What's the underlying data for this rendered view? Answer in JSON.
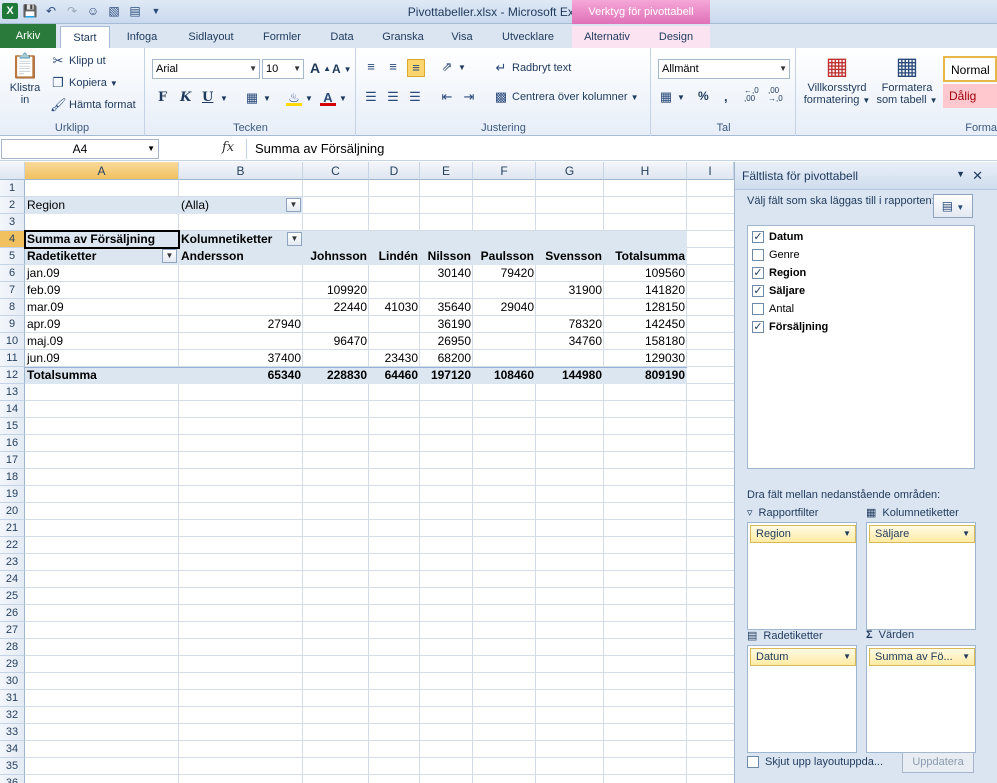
{
  "window": {
    "title": "Pivottabeller.xlsx - Microsoft Excel",
    "context_tool": "Verktyg för pivottabell"
  },
  "tabs": {
    "file": "Arkiv",
    "items": [
      "Start",
      "Infoga",
      "Sidlayout",
      "Formler",
      "Data",
      "Granska",
      "Visa",
      "Utvecklare"
    ],
    "context_items": [
      "Alternativ",
      "Design"
    ],
    "active": "Start"
  },
  "ribbon": {
    "clipboard": {
      "paste_line1": "Klistra",
      "paste_line2": "in",
      "cut": "Klipp ut",
      "copy": "Kopiera",
      "format_painter": "Hämta format",
      "label": "Urklipp"
    },
    "font": {
      "family": "Arial",
      "size": "10",
      "bold": "F",
      "italic": "K",
      "underline": "U",
      "label": "Tecken"
    },
    "alignment": {
      "wrap_text": "Radbryt text",
      "merge_center": "Centrera över kolumner",
      "label": "Justering"
    },
    "number": {
      "format": "Allmänt",
      "percent": "%",
      "comma": ",",
      "inc_decimal": "←,0 ,00",
      "dec_decimal": ",00 →,0",
      "label": "Tal"
    },
    "styles": {
      "cond_format_line1": "Villkorsstyrd",
      "cond_format_line2": "formatering",
      "format_table_line1": "Formatera",
      "format_table_line2": "som tabell",
      "style_normal": "Normal",
      "style_bad": "Dålig",
      "label": "Forma"
    }
  },
  "formula_bar": {
    "name_box": "A4",
    "fx": "fx",
    "content": "Summa av Försäljning"
  },
  "columns": [
    "A",
    "B",
    "C",
    "D",
    "E",
    "F",
    "G",
    "H",
    "I"
  ],
  "selected_column": "A",
  "selected_row": 4,
  "rows": [
    "1",
    "2",
    "3",
    "4",
    "5",
    "6",
    "7",
    "8",
    "9",
    "10",
    "11",
    "12",
    "13",
    "14",
    "15",
    "16",
    "17",
    "18",
    "19",
    "20",
    "21",
    "22",
    "23",
    "24",
    "25",
    "26",
    "27",
    "28",
    "29",
    "30",
    "31",
    "32",
    "33",
    "34",
    "35",
    "36"
  ],
  "pivot": {
    "filter_label": "Region",
    "filter_value": "(Alla)",
    "values_header": "Summa av Försäljning",
    "col_labels": "Kolumnetiketter",
    "row_labels": "Radetiketter",
    "sellers": [
      "Andersson",
      "Johnsson",
      "Lindén",
      "Nilsson",
      "Paulsson",
      "Svensson",
      "Totalsumma"
    ],
    "data_rows": [
      {
        "label": "jan.09",
        "values": [
          "",
          "",
          "",
          "30140",
          "79420",
          "",
          "109560"
        ]
      },
      {
        "label": "feb.09",
        "values": [
          "",
          "109920",
          "",
          "",
          "",
          "31900",
          "141820"
        ]
      },
      {
        "label": "mar.09",
        "values": [
          "",
          "22440",
          "41030",
          "35640",
          "29040",
          "",
          "128150"
        ]
      },
      {
        "label": "apr.09",
        "values": [
          "27940",
          "",
          "",
          "36190",
          "",
          "78320",
          "142450"
        ]
      },
      {
        "label": "maj.09",
        "values": [
          "",
          "96470",
          "",
          "26950",
          "",
          "34760",
          "158180"
        ]
      },
      {
        "label": "jun.09",
        "values": [
          "37400",
          "",
          "23430",
          "68200",
          "",
          "",
          "129030"
        ]
      }
    ],
    "total_row": {
      "label": "Totalsumma",
      "values": [
        "65340",
        "228830",
        "64460",
        "197120",
        "108460",
        "144980",
        "809190"
      ]
    }
  },
  "field_list": {
    "title": "Fältlista för pivottabell",
    "hint": "Välj fält som ska läggas till i rapporten:",
    "fields": [
      {
        "name": "Datum",
        "checked": true
      },
      {
        "name": "Genre",
        "checked": false
      },
      {
        "name": "Region",
        "checked": true
      },
      {
        "name": "Säljare",
        "checked": true
      },
      {
        "name": "Antal",
        "checked": false
      },
      {
        "name": "Försäljning",
        "checked": true
      }
    ],
    "drag_hint": "Dra fält mellan nedanstående områden:",
    "areas": {
      "report_filter": {
        "label": "Rapportfilter",
        "item": "Region"
      },
      "column_labels": {
        "label": "Kolumnetiketter",
        "item": "Säljare"
      },
      "row_labels": {
        "label": "Radetiketter",
        "item": "Datum"
      },
      "values": {
        "label": "Värden",
        "item": "Summa av Fö..."
      }
    },
    "defer_label": "Skjut upp layoutuppda...",
    "update_button": "Uppdatera"
  },
  "icons": {
    "save": "save-icon",
    "undo": "undo-icon",
    "redo": "redo-icon",
    "close": "close-icon",
    "filter": "filter-icon",
    "sigma": "sigma-icon"
  }
}
